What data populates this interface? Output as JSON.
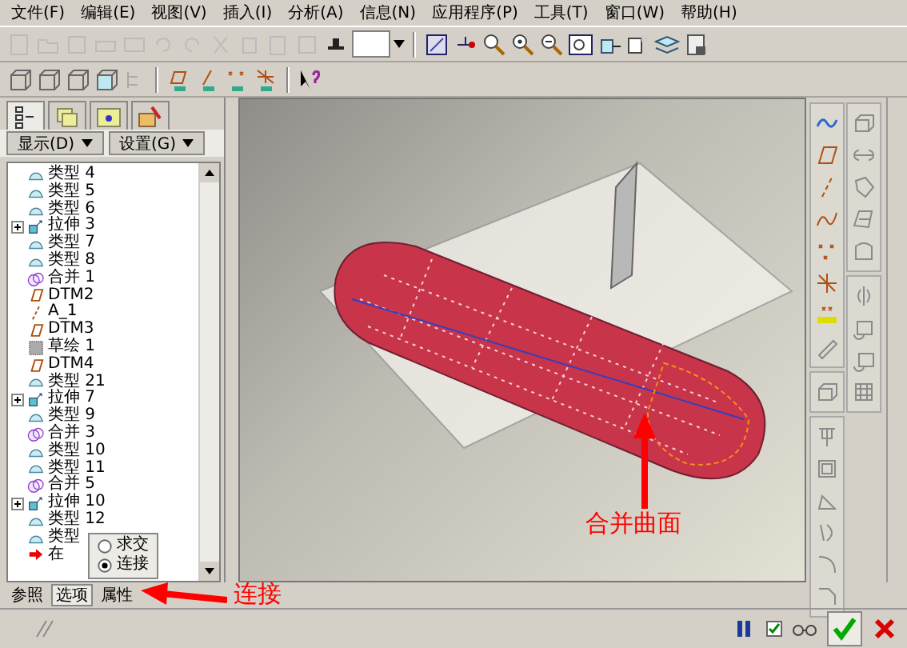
{
  "menu": [
    "文件(F)",
    "编辑(E)",
    "视图(V)",
    "插入(I)",
    "分析(A)",
    "信息(N)",
    "应用程序(P)",
    "工具(T)",
    "窗口(W)",
    "帮助(H)"
  ],
  "left_tabs": [
    {
      "kind": "tree",
      "selected": true
    },
    {
      "kind": "layers",
      "selected": false
    },
    {
      "kind": "folder",
      "selected": false
    },
    {
      "kind": "favorites",
      "selected": false
    }
  ],
  "panel_buttons": [
    "显示(D)",
    "设置(G)"
  ],
  "tree": [
    {
      "label": "类型 4",
      "kind": "surface"
    },
    {
      "label": "类型 5",
      "kind": "surface"
    },
    {
      "label": "类型 6",
      "kind": "surface"
    },
    {
      "label": "拉伸 3",
      "kind": "extrude"
    },
    {
      "label": "类型 7",
      "kind": "surface"
    },
    {
      "label": "类型 8",
      "kind": "surface"
    },
    {
      "label": "合并 1",
      "kind": "merge"
    },
    {
      "label": "DTM2",
      "kind": "plane"
    },
    {
      "label": "A_1",
      "kind": "axis"
    },
    {
      "label": "DTM3",
      "kind": "plane"
    },
    {
      "label": "草绘 1",
      "kind": "sketch"
    },
    {
      "label": "DTM4",
      "kind": "plane"
    },
    {
      "label": "类型 21",
      "kind": "surface"
    },
    {
      "label": "拉伸 7",
      "kind": "extrude"
    },
    {
      "label": "类型 9",
      "kind": "surface"
    },
    {
      "label": "合并 3",
      "kind": "merge"
    },
    {
      "label": "类型 10",
      "kind": "surface"
    },
    {
      "label": "类型 11",
      "kind": "surface"
    },
    {
      "label": "合并 5",
      "kind": "merge"
    },
    {
      "label": "拉伸 10",
      "kind": "extrude"
    },
    {
      "label": "类型 12",
      "kind": "surface"
    },
    {
      "label": "类型",
      "kind": "surface"
    },
    {
      "label": "在",
      "kind": "insert"
    }
  ],
  "popup": {
    "options": [
      {
        "label": "求交",
        "selected": false
      },
      {
        "label": "连接",
        "selected": true
      }
    ]
  },
  "bottom_tabs": [
    {
      "label": "参照",
      "selected": false
    },
    {
      "label": "选项",
      "selected": true
    },
    {
      "label": "属性",
      "selected": false
    }
  ],
  "dashboard": {
    "preview_checked": true
  },
  "annotations": [
    {
      "label": "合并曲面"
    },
    {
      "label": "连接"
    }
  ]
}
